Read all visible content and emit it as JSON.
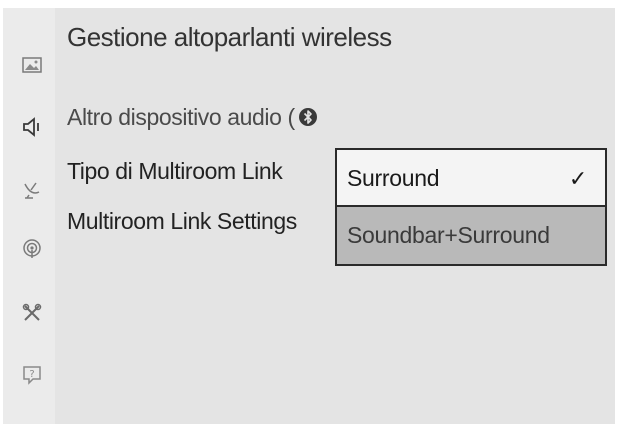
{
  "header": {
    "title": "Gestione altoparlanti wireless"
  },
  "sidebar": {
    "icons": [
      "picture-icon",
      "speaker-icon",
      "satellite-icon",
      "broadcast-icon",
      "tools-icon",
      "help-icon"
    ]
  },
  "menu": {
    "items": [
      {
        "label": "Altro dispositivo audio (",
        "icon": "bluetooth-icon"
      },
      {
        "label": "Tipo di Multiroom Link"
      },
      {
        "label": "Multiroom Link Settings"
      }
    ]
  },
  "dropdown": {
    "options": [
      {
        "label": "Surround",
        "selected": true,
        "check": "✓"
      },
      {
        "label": "Soundbar+Surround",
        "selected": false
      }
    ]
  },
  "colors": {
    "background": "#e4e4e4",
    "selected_option": "#f4f4f4",
    "unselected_option": "#b9b9b9",
    "border": "#2a2a2a"
  }
}
